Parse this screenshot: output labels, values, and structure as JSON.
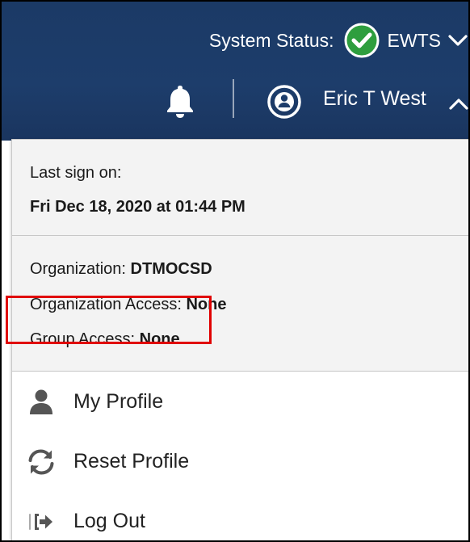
{
  "header": {
    "status_label": "System Status:",
    "status_value": "EWTS",
    "status_icon": "check-circle-icon",
    "status_color": "#2e9e3e",
    "user_name": "Eric T West",
    "bell_icon": "bell-icon",
    "avatar_icon": "user-circle-icon",
    "background": "#1d3d6b"
  },
  "dropdown": {
    "signon": {
      "label": "Last sign on:",
      "value": "Fri Dec 18, 2020 at 01:44 PM"
    },
    "org": {
      "organization_label": "Organization:",
      "organization_value": "DTMOCSD",
      "org_access_label": "Organization Access:",
      "org_access_value": "None",
      "group_access_label": "Group Access:",
      "group_access_value": "None"
    },
    "menu": {
      "my_profile": {
        "label": "My Profile",
        "icon": "user-icon"
      },
      "reset_profile": {
        "label": "Reset Profile",
        "icon": "refresh-icon",
        "highlight_color": "#e00000"
      },
      "log_out": {
        "label": "Log Out",
        "icon": "sign-out-icon"
      }
    }
  }
}
